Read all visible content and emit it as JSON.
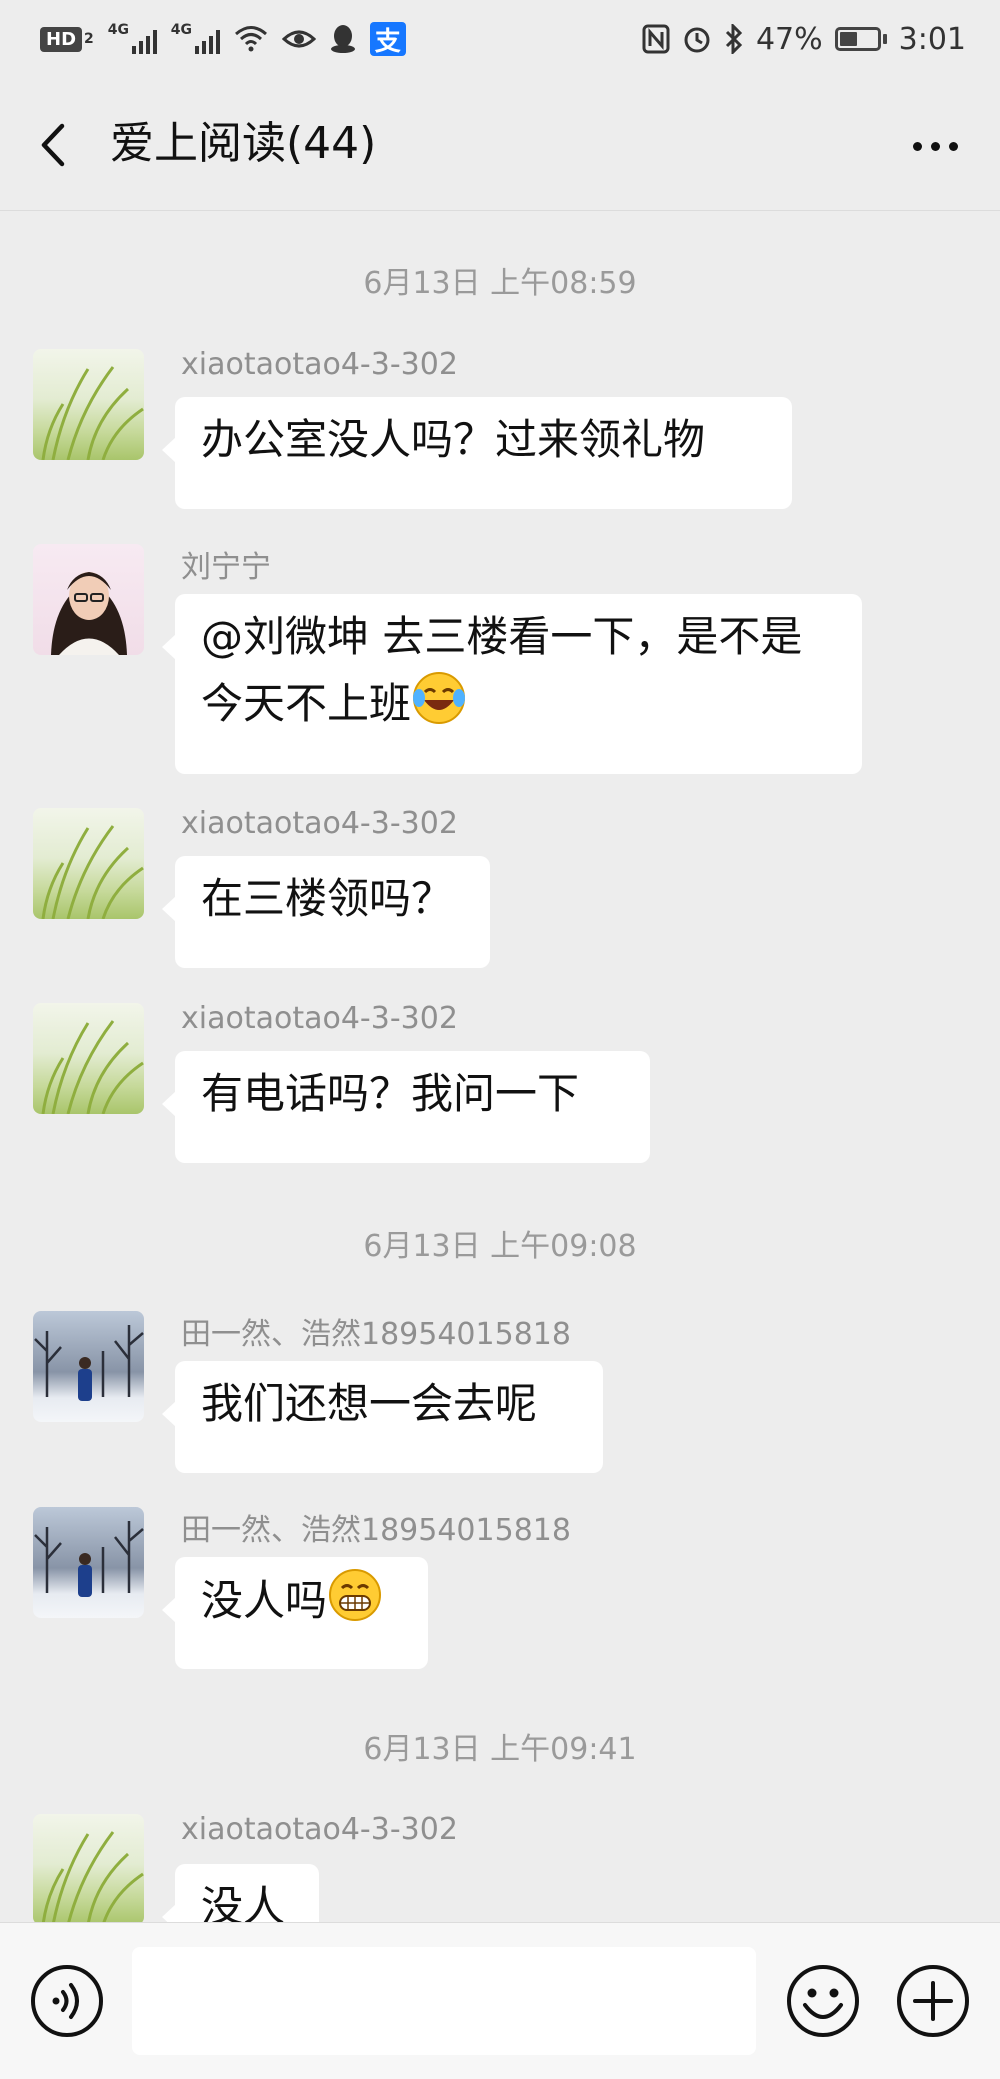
{
  "status_bar": {
    "hd_label": "HD",
    "hd_sub": "2",
    "network_1": "4G",
    "network_2": "4G",
    "alipay_label": "支",
    "battery_percent": "47%",
    "battery_level": 0.47,
    "time": "3:01"
  },
  "header": {
    "title": "爱上阅读(44)"
  },
  "chat": {
    "timestamps": [
      "6月13日 上午08:59",
      "6月13日 上午09:08",
      "6月13日 上午09:41"
    ],
    "messages": [
      {
        "sender": "xiaotaotao4-3-302",
        "text": "办公室没人吗？过来领礼物",
        "avatar": "grass-avatar"
      },
      {
        "sender": "刘宁宁",
        "text": "@刘微坤  去三楼看一下，是不是今天不上班",
        "avatar": "woman-avatar",
        "emoji": "tears-of-joy-emoji"
      },
      {
        "sender": "xiaotaotao4-3-302",
        "text": "在三楼领吗？",
        "avatar": "grass-avatar"
      },
      {
        "sender": "xiaotaotao4-3-302",
        "text": "有电话吗？我问一下",
        "avatar": "grass-avatar"
      },
      {
        "sender": "田一然、浩然18954015818",
        "text": "我们还想一会去呢",
        "avatar": "snow-avatar"
      },
      {
        "sender": "田一然、浩然18954015818",
        "text": "没人吗",
        "avatar": "snow-avatar",
        "emoji": "grin-emoji"
      },
      {
        "sender": "xiaotaotao4-3-302",
        "text": "没人",
        "avatar": "grass-avatar"
      }
    ]
  },
  "input_bar": {
    "voice_icon": "voice-icon",
    "emoji_icon": "smiley-icon",
    "plus_icon": "plus-icon",
    "input_value": ""
  }
}
